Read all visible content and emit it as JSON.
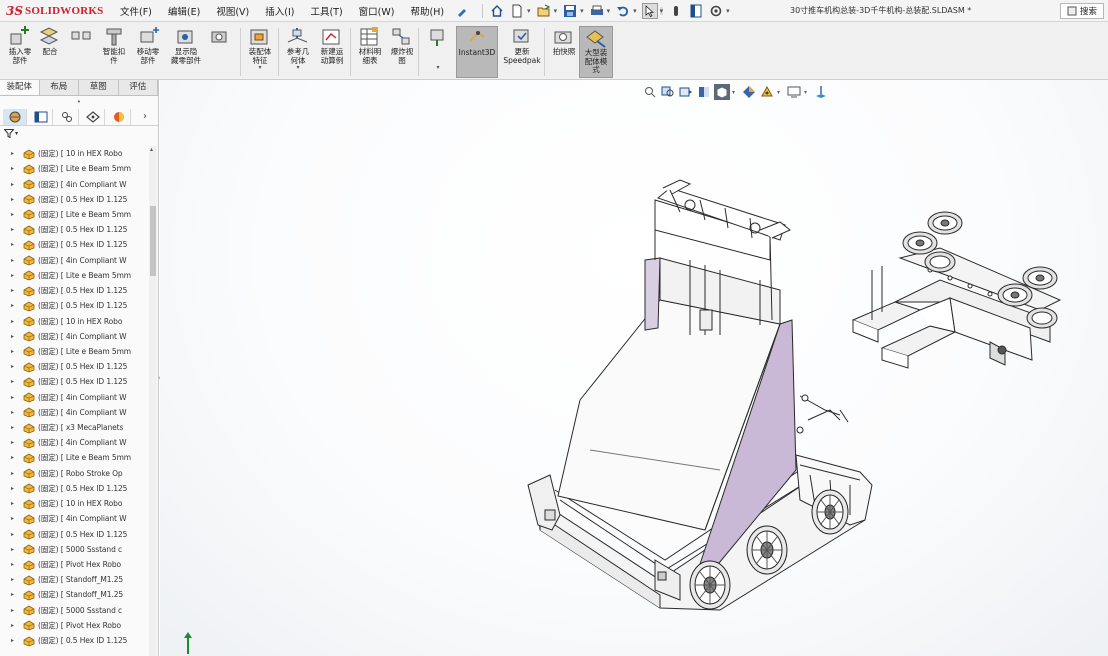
{
  "app": {
    "logo_mark": "3S",
    "logo_text": "SOLIDWORKS",
    "document_title": "30寸推车机构总装-3D千牛机构-总装配.SLDASM *",
    "search_label": "搜索"
  },
  "menu": [
    "文件(F)",
    "编辑(E)",
    "视图(V)",
    "插入(I)",
    "工具(T)",
    "窗口(W)",
    "帮助(H)"
  ],
  "quick_access_icons": [
    "home-icon",
    "new-file-icon",
    "open-icon",
    "save-icon",
    "print-icon",
    "undo-icon",
    "select-icon",
    "rebuild-icon",
    "file-props-icon",
    "options-icon"
  ],
  "ribbon": {
    "buttons": [
      {
        "label": "插入零\n部件",
        "icon": "insert-component-icon"
      },
      {
        "label": "配合",
        "icon": "mate-icon"
      },
      {
        "label": "",
        "icon": "linear-pattern-icon"
      },
      {
        "label": "智能扣\n件",
        "icon": "smart-fastener-icon"
      },
      {
        "label": "移动零\n部件",
        "icon": "move-component-icon"
      },
      {
        "label": "显示隐\n藏零部件",
        "icon": "show-hidden-icon"
      },
      {
        "label": "装配体\n特征",
        "icon": "assembly-feature-icon"
      },
      {
        "label": "参考几\n何体",
        "icon": "reference-geometry-icon"
      },
      {
        "label": "新建运\n动算例",
        "icon": "motion-study-icon"
      },
      {
        "label": "材料明\n细表",
        "icon": "bom-icon"
      },
      {
        "label": "爆炸视\n图",
        "icon": "exploded-view-icon"
      },
      {
        "label": "Instant3D",
        "icon": "instant3d-icon"
      },
      {
        "label": "更新\nSpeedpak",
        "icon": "speedpak-icon"
      },
      {
        "label": "拍快照",
        "icon": "snapshot-icon"
      },
      {
        "label": "大型装\n配体模\n式",
        "icon": "large-assembly-icon"
      }
    ]
  },
  "panel": {
    "tabs": [
      "装配体",
      "布局",
      "草图",
      "评估"
    ],
    "filter_label": "▼"
  },
  "tree_items": [
    "(固定) [ 10 in HEX Robo",
    "(固定) [ Lite e Beam 5mm",
    "(固定) [ 4in Compliant W",
    "(固定) [ 0.5 Hex ID 1.125",
    "(固定) [ Lite e Beam 5mm",
    "(固定) [ 0.5 Hex ID 1.125",
    "(固定) [ 0.5 Hex ID 1.125",
    "(固定) [ 4in Compliant W",
    "(固定) [ Lite e Beam 5mm",
    "(固定) [ 0.5 Hex ID 1.125",
    "(固定) [ 0.5 Hex ID 1.125",
    "(固定) [ 10 in HEX Robo",
    "(固定) [ 4in Compliant W",
    "(固定) [ Lite e Beam 5mm",
    "(固定) [ 0.5 Hex ID 1.125",
    "(固定) [ 0.5 Hex ID 1.125",
    "(固定) [ 4in Compliant W",
    "(固定) [ 4in Compliant W",
    "(固定) [ x3 MecaPlanets",
    "(固定) [ 4in Compliant W",
    "(固定) [ Lite e Beam 5mm",
    "(固定) [ Robo Stroke Op",
    "(固定) [ 0.5 Hex ID 1.125",
    "(固定) [ 10 in HEX Robo",
    "(固定) [ 4in Compliant W",
    "(固定) [ 0.5 Hex ID 1.125",
    "(固定) [ 5000 Ssstand c",
    "(固定) [ Pivot Hex Robo",
    "(固定) [ Standoff_M1.25",
    "(固定) [ Standoff_M1.25",
    "(固定) [ 5000 Ssstand c",
    "(固定) [ Pivot Hex Robo",
    "(固定) [ 0.5 Hex ID 1.125"
  ],
  "heads_up_icons": [
    "zoom-fit-icon",
    "zoom-area-icon",
    "previous-view-icon",
    "section-view-icon",
    "view-orientation-icon",
    "display-style-icon",
    "hide-show-icon",
    "edit-appearance-icon",
    "apply-scene-icon",
    "view-settings-icon"
  ],
  "colors": {
    "accent": "#d0202e",
    "part_icon": "#f0b93a",
    "model_side": "#c9b8d6",
    "model_line": "#2b2b2b",
    "active_button": "#b9b9b9"
  }
}
